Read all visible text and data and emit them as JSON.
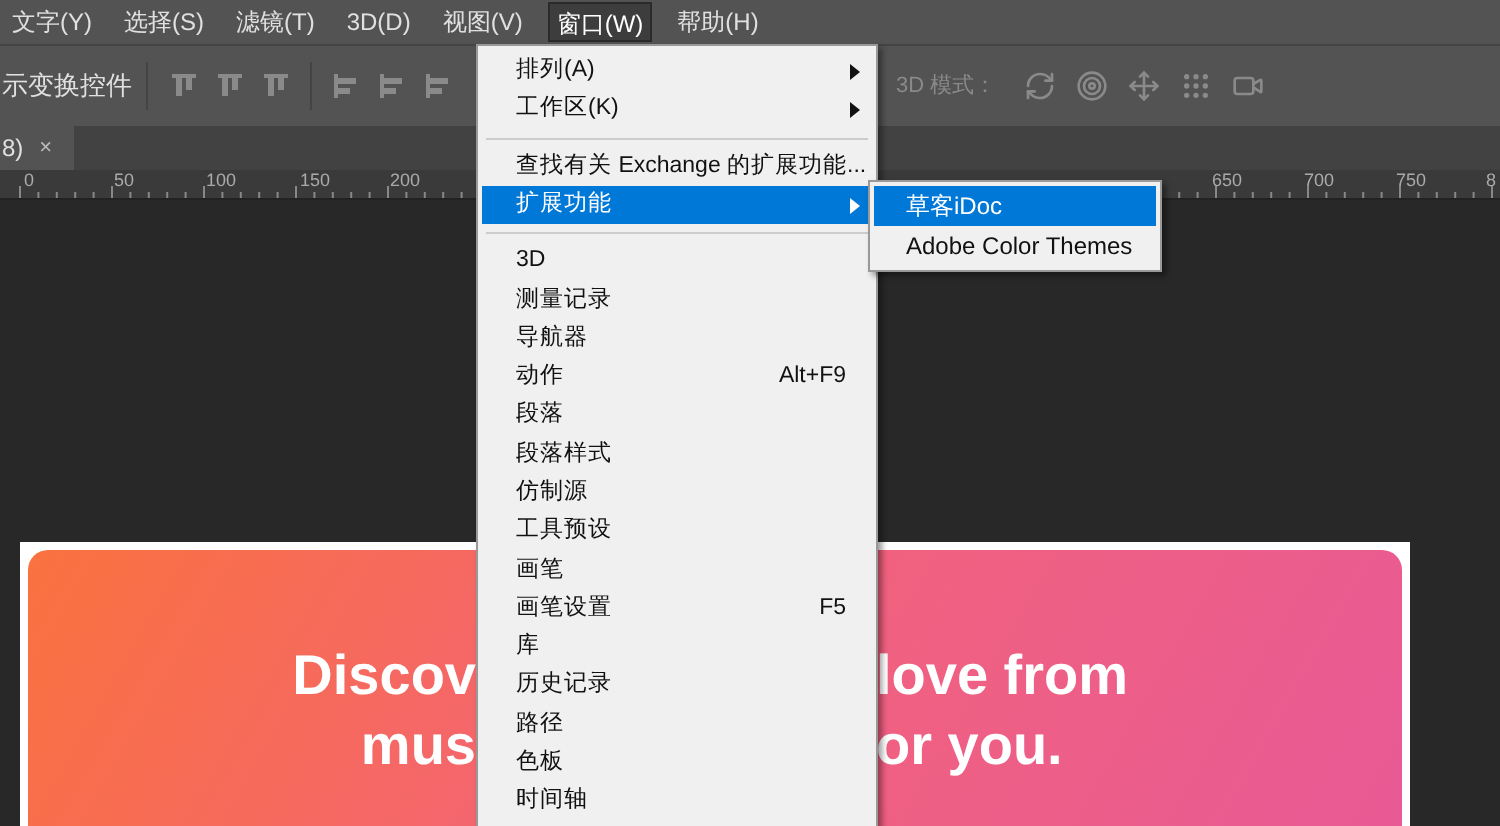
{
  "menu_bar": [
    {
      "label": "文字(Y)",
      "selected": false
    },
    {
      "label": "选择(S)",
      "selected": false
    },
    {
      "label": "滤镜(T)",
      "selected": false
    },
    {
      "label": "3D(D)",
      "selected": false
    },
    {
      "label": "视图(V)",
      "selected": false
    },
    {
      "label": "窗口(W)",
      "selected": true
    },
    {
      "label": "帮助(H)",
      "selected": false
    }
  ],
  "options_bar": {
    "transform_label": "示变换控件",
    "mode_label": "3D 模式："
  },
  "document_tab": {
    "label": "8)",
    "close": "×"
  },
  "ruler": {
    "ticks": [
      "0",
      "50",
      "100",
      "150",
      "200",
      "650",
      "700",
      "750",
      "8"
    ]
  },
  "canvas": {
    "headline_lines": [
      {
        "left": "Discov",
        "right": "love from"
      },
      {
        "left": "mus",
        "right": "or you."
      }
    ]
  },
  "window_menu": {
    "items": [
      {
        "kind": "item",
        "label": "排列(A)",
        "has_submenu": true,
        "selected": false
      },
      {
        "kind": "item",
        "label": "工作区(K)",
        "has_submenu": true,
        "selected": false
      },
      {
        "kind": "separator"
      },
      {
        "kind": "item",
        "label": "查找有关 Exchange 的扩展功能...",
        "has_submenu": false,
        "selected": false
      },
      {
        "kind": "item",
        "label": "扩展功能",
        "has_submenu": true,
        "selected": true
      },
      {
        "kind": "separator"
      },
      {
        "kind": "item",
        "label": "3D",
        "has_submenu": false,
        "selected": false
      },
      {
        "kind": "item",
        "label": "测量记录",
        "has_submenu": false,
        "selected": false
      },
      {
        "kind": "item",
        "label": "导航器",
        "has_submenu": false,
        "selected": false
      },
      {
        "kind": "item",
        "label": "动作",
        "shortcut": "Alt+F9",
        "has_submenu": false,
        "selected": false
      },
      {
        "kind": "item",
        "label": "段落",
        "has_submenu": false,
        "selected": false
      },
      {
        "kind": "item",
        "label": "段落样式",
        "has_submenu": false,
        "selected": false
      },
      {
        "kind": "item",
        "label": "仿制源",
        "has_submenu": false,
        "selected": false
      },
      {
        "kind": "item",
        "label": "工具预设",
        "has_submenu": false,
        "selected": false
      },
      {
        "kind": "item",
        "label": "画笔",
        "has_submenu": false,
        "selected": false
      },
      {
        "kind": "item",
        "label": "画笔设置",
        "shortcut": "F5",
        "has_submenu": false,
        "selected": false
      },
      {
        "kind": "item",
        "label": "库",
        "has_submenu": false,
        "selected": false
      },
      {
        "kind": "item",
        "label": "历史记录",
        "has_submenu": false,
        "selected": false
      },
      {
        "kind": "item",
        "label": "路径",
        "has_submenu": false,
        "selected": false
      },
      {
        "kind": "item",
        "label": "色板",
        "has_submenu": false,
        "selected": false
      },
      {
        "kind": "item",
        "label": "时间轴",
        "has_submenu": false,
        "selected": false
      }
    ]
  },
  "extensions_submenu": {
    "items": [
      {
        "label": "草客iDoc",
        "selected": true
      },
      {
        "label": "Adobe Color Themes",
        "selected": false
      }
    ]
  }
}
